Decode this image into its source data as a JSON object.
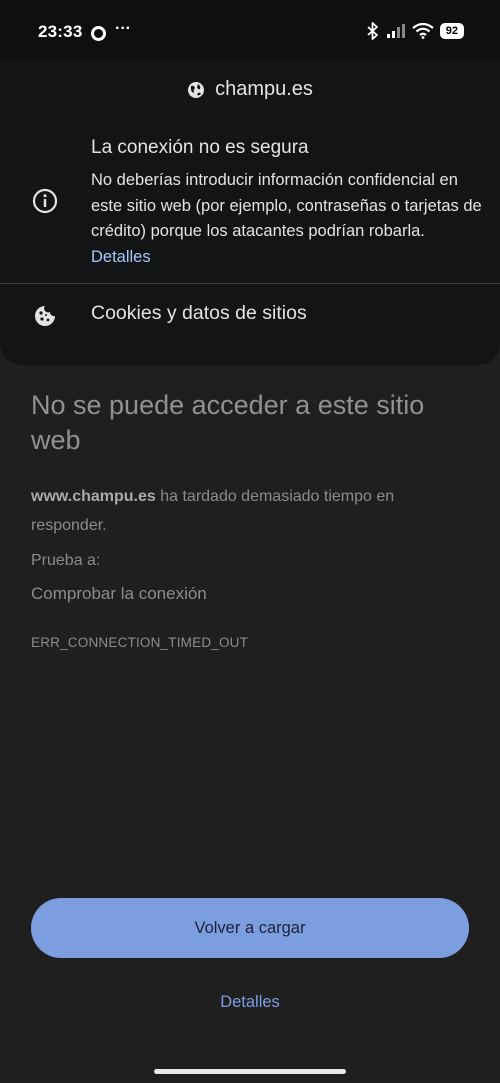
{
  "status_bar": {
    "time": "23:33",
    "dots": "···",
    "battery": "92"
  },
  "site_info": {
    "domain": "champu.es",
    "connection_title": "La conexión no es segura",
    "connection_body": "No deberías introducir información confidencial en este sitio web (por ejemplo, contraseñas o tarjetas de crédito) porque los atacantes podrían robarla.",
    "details_link": "Detalles",
    "cookies_label": "Cookies y datos de sitios"
  },
  "error_page": {
    "heading": "No se puede acceder a este sitio web",
    "url": "www.champu.es",
    "desc_suffix": " ha tardado demasiado tiempo en responder.",
    "try_label": "Prueba a:",
    "try_item": "Comprobar la conexión",
    "error_code": "ERR_CONNECTION_TIMED_OUT",
    "reload_label": "Volver a cargar",
    "details_label": "Detalles"
  },
  "colors": {
    "accent": "#7c9ee0",
    "link": "#a8c7fa"
  }
}
